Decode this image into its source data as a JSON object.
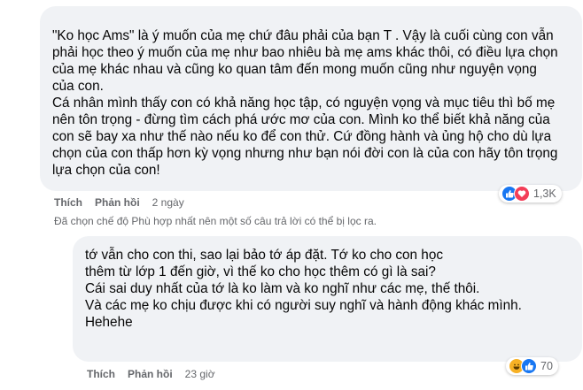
{
  "comments": [
    {
      "text": "\"Ko học Ams\" là ý muốn của mẹ chứ đâu phải của bạn T     . Vậy là cuối cùng con vẫn\nphải học theo ý muốn của mẹ như bao nhiêu bà mẹ ams khác thôi, có điều lựa chọn\ncủa mẹ khác nhau và cũng ko quan tâm đến mong muốn cũng như nguyện vọng\ncủa con.\nCá nhân mình thấy con có khả năng học tập, có nguyện vọng và mục tiêu thì bố mẹ\nnên tôn trọng - đừng tìm cách phá ước mơ của con. Mình ko thể biết khả năng của\ncon sẽ bay xa như thế nào nếu ko để con thử. Cứ đồng hành và ủng hộ cho dù lựa\nchọn của con thấp hơn kỳ vọng nhưng như bạn nói đời con là của con hãy tôn trọng\nlựa chọn của con!",
      "like_label": "Thích",
      "reply_label": "Phản hồi",
      "time": "2 ngày",
      "reaction_count": "1,3K",
      "reactions": [
        "like-icon",
        "love-icon"
      ]
    },
    {
      "text": "tớ vẫn cho con thi, sao lại bảo tớ áp đặt. Tớ ko cho con học\nthêm từ lớp 1 đến giờ, vì thế ko cho học thêm có gì là sai?\nCái sai duy nhất của tớ là ko làm và ko nghĩ như các mẹ, thế thôi.\nVà các mẹ ko chịu được khi có người suy nghĩ và hành động khác mình.\nHehehe",
      "like_label": "Thích",
      "reply_label": "Phản hồi",
      "time": "23 giờ",
      "reaction_count": "70",
      "reactions": [
        "haha-icon",
        "like-icon"
      ]
    }
  ],
  "notice": "Đã chọn chế độ Phù hợp nhất nên một số câu trả lời có thể bị lọc ra.",
  "colors": {
    "bubble": "#f0f2f5",
    "secondary_text": "#65676b",
    "like": "#1877f2",
    "love": "#f33e58",
    "haha": "#f7b125"
  }
}
